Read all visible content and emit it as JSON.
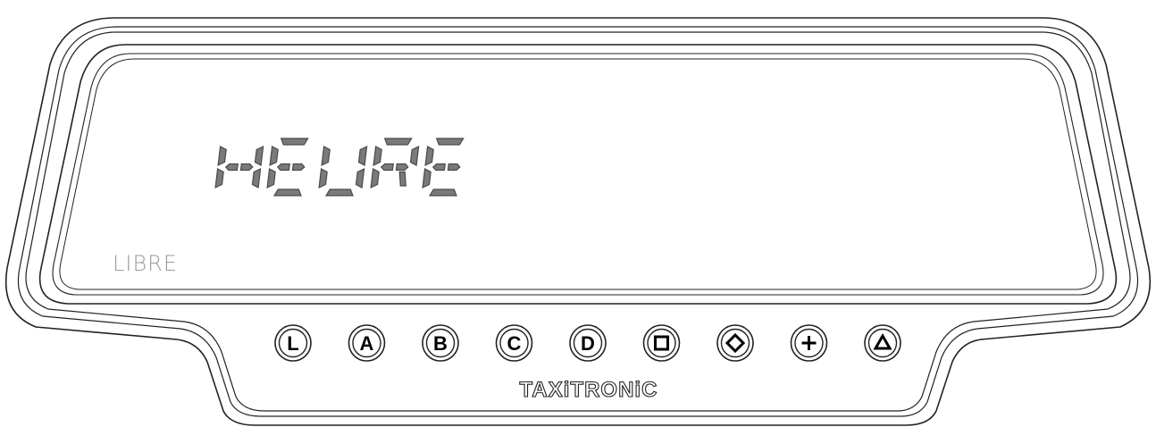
{
  "display": {
    "main_text": "HEURE",
    "status_text": "LIBRE"
  },
  "buttons": [
    {
      "id": "L",
      "label": "L",
      "symbol": "text"
    },
    {
      "id": "A",
      "label": "A",
      "symbol": "text"
    },
    {
      "id": "B",
      "label": "B",
      "symbol": "text"
    },
    {
      "id": "C",
      "label": "C",
      "symbol": "text"
    },
    {
      "id": "D",
      "label": "D",
      "symbol": "text"
    },
    {
      "id": "square",
      "label": "",
      "symbol": "square-icon"
    },
    {
      "id": "diamond",
      "label": "",
      "symbol": "diamond-icon"
    },
    {
      "id": "plus",
      "label": "",
      "symbol": "plus-icon"
    },
    {
      "id": "triangle",
      "label": "",
      "symbol": "triangle-icon"
    }
  ],
  "brand": "TAXiTRONiC",
  "colors": {
    "segment_on": "#7a7a7a",
    "status_text": "#9a9a9a",
    "outline": "#222222"
  }
}
